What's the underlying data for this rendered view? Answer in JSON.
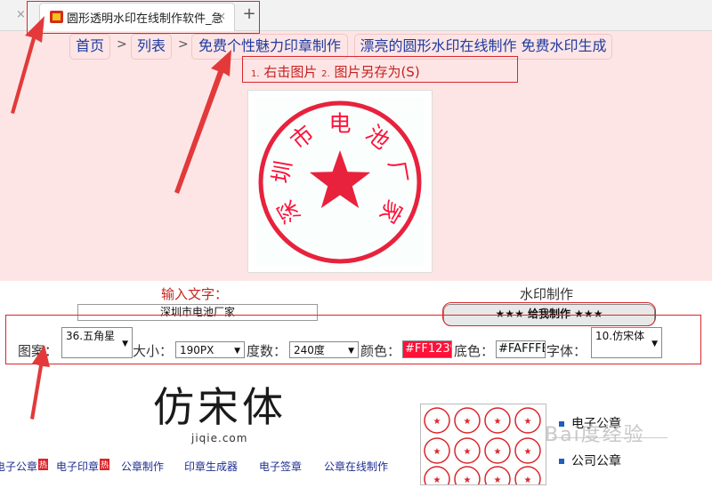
{
  "browser": {
    "tab_title": "圆形透明水印在线制作软件_急",
    "close_glyph": "×",
    "new_tab_glyph": "+"
  },
  "nav": {
    "home": "首页",
    "sep": ">",
    "list": "列表",
    "crumb3": "免费个性魅力印章制作",
    "crumb4": "漂亮的圆形水印在线制作 免费水印生成"
  },
  "instructions": {
    "n1": "1.",
    "t1": "右击图片",
    "n2": "2.",
    "t2": "图片另存为(S)"
  },
  "stamp": {
    "text": "深圳市电池厂家",
    "color": "#FF1239",
    "background": "#FAFFFE",
    "icon": "star-icon"
  },
  "form": {
    "input_label": "输入文字：",
    "input_value": "深圳市电池厂家",
    "make_label": "水印制作",
    "make_button": "★★★ 给我制作 ★★★",
    "pattern_label": "图案：",
    "pattern_value": "36.五角星",
    "size_label": "大小：",
    "size_value": "190PX",
    "degree_label": "度数：",
    "degree_value": "240度",
    "color_label": "颜色：",
    "color_value": "#FF1239",
    "bg_label": "底色：",
    "bg_value": "#FAFFFE",
    "font_label": "字体：",
    "font_value": "10.仿宋体"
  },
  "font_preview": {
    "title": "仿宋体",
    "subtitle": "jiqie.com"
  },
  "bottom_links": [
    {
      "label": "电子公章",
      "hot": "热"
    },
    {
      "label": "电子印章",
      "hot": "热"
    },
    {
      "label": "公章制作",
      "hot": ""
    },
    {
      "label": "印章生成器",
      "hot": ""
    },
    {
      "label": "电子签章",
      "hot": ""
    },
    {
      "label": "公章在线制作",
      "hot": ""
    }
  ],
  "side_links": [
    "电子公章",
    "公司公章"
  ],
  "watermark": "Bai度经验",
  "colors": {
    "accent_red": "#d9262b",
    "pink_band": "#fde5e5",
    "link_blue": "#1e3aa0"
  }
}
